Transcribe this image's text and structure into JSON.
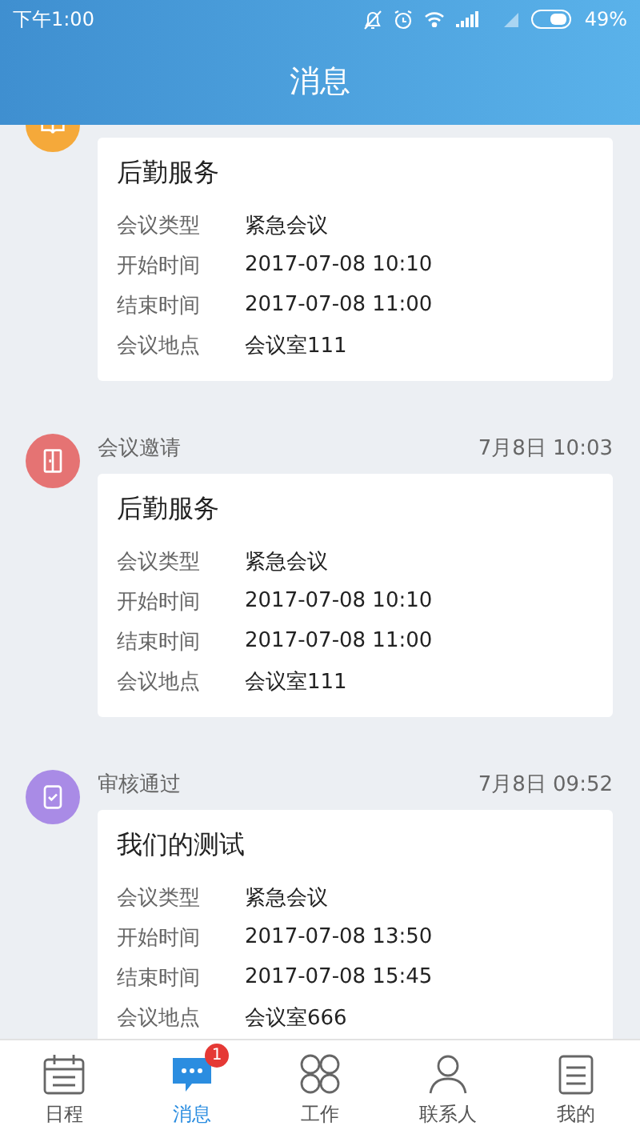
{
  "status_bar": {
    "time": "下午1:00",
    "battery": "49%"
  },
  "title": "消息",
  "messages": [
    {
      "kind": "book",
      "color": "#f5a93a",
      "title": "后勤服务",
      "fields": [
        {
          "label": "会议类型",
          "value": "紧急会议"
        },
        {
          "label": "开始时间",
          "value": "2017-07-08 10:10"
        },
        {
          "label": "结束时间",
          "value": "2017-07-08 11:00"
        },
        {
          "label": "会议地点",
          "value": "会议室111"
        }
      ]
    },
    {
      "kind": "door",
      "color": "#e57373",
      "category": "会议邀请",
      "time": "7月8日 10:03",
      "title": "后勤服务",
      "fields": [
        {
          "label": "会议类型",
          "value": "紧急会议"
        },
        {
          "label": "开始时间",
          "value": "2017-07-08 10:10"
        },
        {
          "label": "结束时间",
          "value": "2017-07-08 11:00"
        },
        {
          "label": "会议地点",
          "value": "会议室111"
        }
      ]
    },
    {
      "kind": "check",
      "color": "#a98be6",
      "category": "审核通过",
      "time": "7月8日 09:52",
      "title": "我们的测试",
      "fields": [
        {
          "label": "会议类型",
          "value": "紧急会议"
        },
        {
          "label": "开始时间",
          "value": "2017-07-08 13:50"
        },
        {
          "label": "结束时间",
          "value": "2017-07-08 15:45"
        },
        {
          "label": "会议地点",
          "value": "会议室666"
        }
      ]
    }
  ],
  "tabs": [
    {
      "kind": "calendar",
      "label": "日程",
      "selected": false
    },
    {
      "kind": "chat",
      "label": "消息",
      "selected": true,
      "badge": "1"
    },
    {
      "kind": "grid",
      "label": "工作",
      "selected": false
    },
    {
      "kind": "person",
      "label": "联系人",
      "selected": false
    },
    {
      "kind": "doc",
      "label": "我的",
      "selected": false
    }
  ]
}
